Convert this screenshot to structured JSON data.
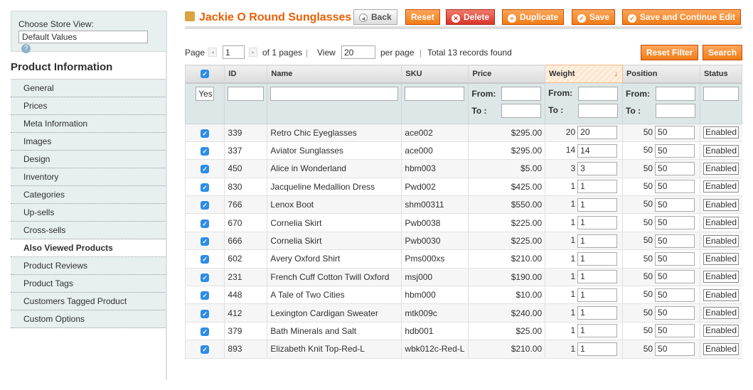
{
  "sidebar": {
    "store_label": "Choose Store View:",
    "store_value": "Default Values",
    "title": "Product Information",
    "tabs": [
      "General",
      "Prices",
      "Meta Information",
      "Images",
      "Design",
      "Inventory",
      "Categories",
      "Up-sells",
      "Cross-sells",
      "Also Viewed Products",
      "Product Reviews",
      "Product Tags",
      "Customers Tagged Product",
      "Custom Options"
    ],
    "active_tab": "Also Viewed Products"
  },
  "header": {
    "title": "Jackie O Round Sunglasses",
    "back": "Back",
    "reset": "Reset",
    "delete": "Delete",
    "duplicate": "Duplicate",
    "save": "Save",
    "save_continue": "Save and Continue Edit"
  },
  "pager": {
    "page_label": "Page",
    "page": "1",
    "of_pages": "of 1 pages",
    "view_label": "View",
    "per_page": "20",
    "per_page_label": "per page",
    "total": "Total 13 records found",
    "reset_filter": "Reset Filter",
    "search": "Search"
  },
  "grid": {
    "columns": [
      "ID",
      "Name",
      "SKU",
      "Price",
      "Weight",
      "Position",
      "Status"
    ],
    "filter_yes": "Yes",
    "from": "From:",
    "to": "To :",
    "rows": [
      {
        "id": "339",
        "name": "Retro Chic Eyeglasses",
        "sku": "ace002",
        "price": "$295.00",
        "weight": "20",
        "weight_in": "20",
        "position": "50",
        "position_in": "50",
        "status": "Enabled"
      },
      {
        "id": "337",
        "name": "Aviator Sunglasses",
        "sku": "ace000",
        "price": "$295.00",
        "weight": "14",
        "weight_in": "14",
        "position": "50",
        "position_in": "50",
        "status": "Enabled"
      },
      {
        "id": "450",
        "name": "Alice in Wonderland",
        "sku": "hbm003",
        "price": "$5.00",
        "weight": "3",
        "weight_in": "3",
        "position": "50",
        "position_in": "50",
        "status": "Enabled"
      },
      {
        "id": "830",
        "name": "Jacqueline Medallion Dress",
        "sku": "Pwd002",
        "price": "$425.00",
        "weight": "1",
        "weight_in": "1",
        "position": "50",
        "position_in": "50",
        "status": "Enabled"
      },
      {
        "id": "766",
        "name": "Lenox Boot",
        "sku": "shm00311",
        "price": "$550.00",
        "weight": "1",
        "weight_in": "1",
        "position": "50",
        "position_in": "50",
        "status": "Enabled"
      },
      {
        "id": "670",
        "name": "Cornelia Skirt",
        "sku": "Pwb0038",
        "price": "$225.00",
        "weight": "1",
        "weight_in": "1",
        "position": "50",
        "position_in": "50",
        "status": "Enabled"
      },
      {
        "id": "666",
        "name": "Cornelia Skirt",
        "sku": "Pwb0030",
        "price": "$225.00",
        "weight": "1",
        "weight_in": "1",
        "position": "50",
        "position_in": "50",
        "status": "Enabled"
      },
      {
        "id": "602",
        "name": "Avery Oxford Shirt",
        "sku": "Pms000xs",
        "price": "$210.00",
        "weight": "1",
        "weight_in": "1",
        "position": "50",
        "position_in": "50",
        "status": "Enabled"
      },
      {
        "id": "231",
        "name": "French Cuff Cotton Twill Oxford",
        "sku": "msj000",
        "price": "$190.00",
        "weight": "1",
        "weight_in": "1",
        "position": "50",
        "position_in": "50",
        "status": "Enabled"
      },
      {
        "id": "448",
        "name": "A Tale of Two Cities",
        "sku": "hbm000",
        "price": "$10.00",
        "weight": "1",
        "weight_in": "1",
        "position": "50",
        "position_in": "50",
        "status": "Enabled"
      },
      {
        "id": "412",
        "name": "Lexington Cardigan Sweater",
        "sku": "mtk009c",
        "price": "$240.00",
        "weight": "1",
        "weight_in": "1",
        "position": "50",
        "position_in": "50",
        "status": "Enabled"
      },
      {
        "id": "379",
        "name": "Bath Minerals and Salt",
        "sku": "hdb001",
        "price": "$25.00",
        "weight": "1",
        "weight_in": "1",
        "position": "50",
        "position_in": "50",
        "status": "Enabled"
      },
      {
        "id": "893",
        "name": "Elizabeth Knit Top-Red-L",
        "sku": "wbk012c-Red-L",
        "price": "$210.00",
        "weight": "1",
        "weight_in": "1",
        "position": "50",
        "position_in": "50",
        "status": "Enabled"
      }
    ]
  }
}
